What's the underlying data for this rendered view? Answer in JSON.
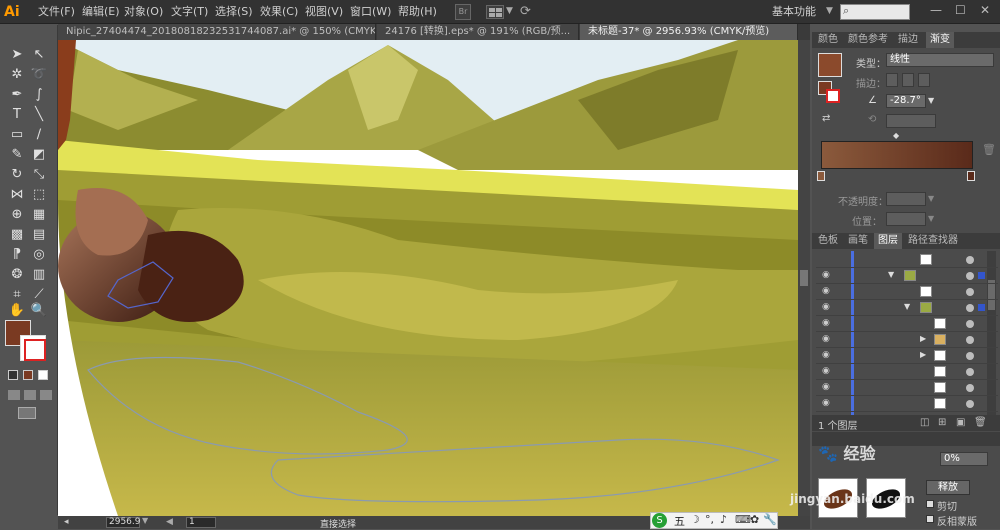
{
  "app": {
    "logo": "Ai",
    "workspace": "基本功能"
  },
  "menu": [
    "文件(F)",
    "编辑(E)",
    "对象(O)",
    "文字(T)",
    "选择(S)",
    "效果(C)",
    "视图(V)",
    "窗口(W)",
    "帮助(H)"
  ],
  "toolbar_misc": {
    "br_label": "Br",
    "search_placeholder": ""
  },
  "window_controls": {
    "minimize": "—",
    "maximize": "☐",
    "close": "✕"
  },
  "tabs": [
    {
      "label": "Nipic_27404474_20180818232531744087.ai* @ 150% (CMYK/..."
    },
    {
      "label": "24176 [转换].eps* @ 191% (RGB/预..."
    },
    {
      "label": "未标题-37* @ 2956.93% (CMYK/预览)"
    }
  ],
  "status": {
    "zoom": "2956.9",
    "artboard": "1",
    "tool_text": "直接选择"
  },
  "color_panel": {
    "tabs": [
      "颜色",
      "颜色参考",
      "描边",
      "渐变"
    ],
    "type_label": "类型：",
    "type_value": "线性",
    "stroke_label": "描边：",
    "angle_value": "-28.7°",
    "opacity_label": "不透明度：",
    "position_label": "位置：",
    "gradient_start": "#8b5a3c",
    "gradient_end": "#5a2a1a",
    "fill_color": "#7a3a22"
  },
  "layers_panel": {
    "tabs": [
      "色板",
      "画笔",
      "图层",
      "路径查找器"
    ],
    "count_label": "1 个图层"
  },
  "transparency_panel": {
    "release_label": "释放",
    "clip_label": "剪切",
    "invert_label": "反相蒙版",
    "opacity_value": "0%"
  },
  "watermark": {
    "site": "jingyan.baidu.com"
  },
  "ime": {
    "label": "五"
  }
}
